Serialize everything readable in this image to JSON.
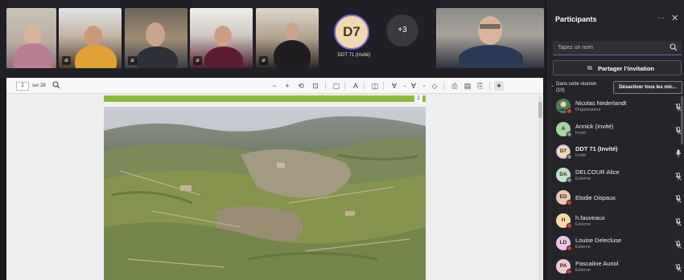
{
  "meeting": {
    "tiles": [
      {
        "id": "tile-1"
      },
      {
        "id": "tile-2"
      },
      {
        "id": "tile-3"
      },
      {
        "id": "tile-4"
      },
      {
        "id": "tile-5"
      }
    ],
    "avatar_tile": {
      "initials": "D7",
      "name": "DDT 71 (Invité)"
    },
    "overflow": {
      "label": "+3"
    }
  },
  "viewer": {
    "page_current": "2",
    "page_total": "sur 28",
    "page_badge": "2",
    "toolbar_icons": [
      "search-icon",
      "minus-icon",
      "plus-icon",
      "rotate-icon",
      "fit-page-icon",
      "page-view-icon",
      "read-aloud-icon",
      "two-page-icon",
      "draw-icon",
      "chevron-down-icon",
      "highlight-icon",
      "chevron-down-icon",
      "eraser-icon",
      "save-icon",
      "print-icon",
      "save-as-icon",
      "pin-icon"
    ]
  },
  "panel": {
    "title": "Participants",
    "more": "···",
    "close": "✕",
    "search_placeholder": "Tapez un nom",
    "share_label": "Partager l’invitation",
    "section_label": "Dans cette réunion (10)",
    "mute_all_label": "Désactiver tous les mic...",
    "participants": [
      {
        "initials": "",
        "name": "Nicolas Nederlandt",
        "role": "Organisateur",
        "avatar_color": "#6fa86a",
        "status_color": "#d23b3b",
        "photo": true
      },
      {
        "initials": "A",
        "name": "Annick (Invité)",
        "role": "Invité",
        "avatar_color": "#a8d5a2",
        "status_color": "#8a8a8a"
      },
      {
        "initials": "D7",
        "name": "DDT 71 (Invité)",
        "role": "Invité",
        "avatar_color": "#f1d9b3",
        "status_color": "#8a8a8a",
        "selected": true
      },
      {
        "initials": "DA",
        "name": "DELCOUR Alice",
        "role": "Externe",
        "avatar_color": "#bfe3c9",
        "status_color": "#8a8a8a"
      },
      {
        "initials": "ED",
        "name": "Elodie Dispaux",
        "role": "",
        "avatar_color": "#e9c9b6",
        "status_color": "#d23b3b"
      },
      {
        "initials": "H",
        "name": "h.fauveaux",
        "role": "Externe",
        "avatar_color": "#f6d9a8",
        "status_color": "#d23b3b"
      },
      {
        "initials": "LD",
        "name": "Louise Delecluse",
        "role": "Externe",
        "avatar_color": "#e9c4e6",
        "status_color": "#d23b3b"
      },
      {
        "initials": "PA",
        "name": "Pascaline Auriol",
        "role": "Externe",
        "avatar_color": "#f1c7d2",
        "status_color": "#d23b3b"
      }
    ]
  }
}
